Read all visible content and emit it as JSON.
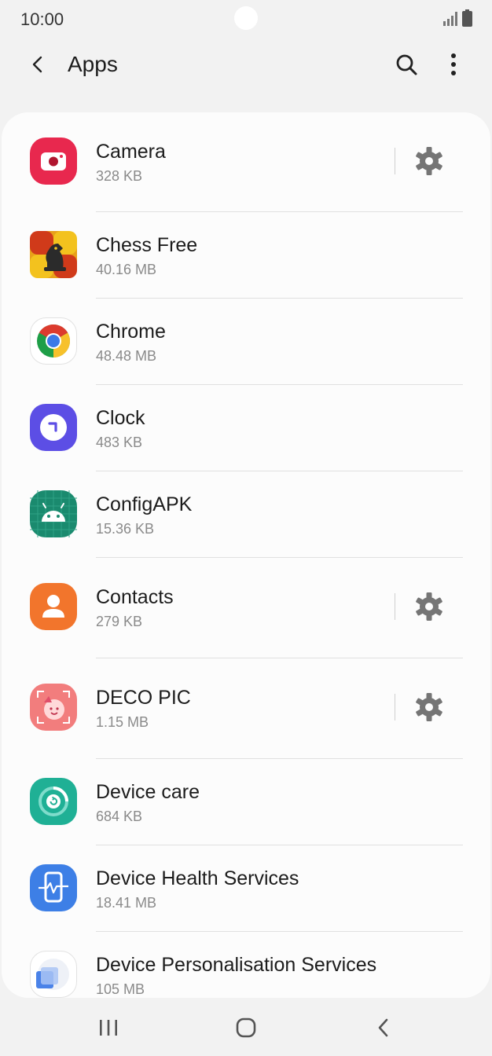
{
  "status_bar": {
    "time": "10:00"
  },
  "app_bar": {
    "title": "Apps"
  },
  "apps": [
    {
      "name": "Camera",
      "size": "328 KB",
      "has_settings": true
    },
    {
      "name": "Chess Free",
      "size": "40.16 MB",
      "has_settings": false
    },
    {
      "name": "Chrome",
      "size": "48.48 MB",
      "has_settings": false
    },
    {
      "name": "Clock",
      "size": "483 KB",
      "has_settings": false
    },
    {
      "name": "ConfigAPK",
      "size": "15.36 KB",
      "has_settings": false
    },
    {
      "name": "Contacts",
      "size": "279 KB",
      "has_settings": true
    },
    {
      "name": "DECO PIC",
      "size": "1.15 MB",
      "has_settings": true
    },
    {
      "name": "Device care",
      "size": "684 KB",
      "has_settings": false
    },
    {
      "name": "Device Health Services",
      "size": "18.41 MB",
      "has_settings": false
    },
    {
      "name": "Device Personalisation Services",
      "size": "105 MB",
      "has_settings": false
    }
  ],
  "icons": {
    "back": "arrow-back-icon",
    "search": "search-icon",
    "more": "more-vertical-icon",
    "settings": "gear-icon",
    "nav_recents": "recents-icon",
    "nav_home": "home-icon",
    "nav_back": "nav-back-icon"
  },
  "colors": {
    "background": "#f2f2f2",
    "card": "#fcfcfc",
    "camera": "#e8284e",
    "clock": "#5c4ee5",
    "configapk": "#1a8a6e",
    "contacts": "#f2752c",
    "decopic": "#f27d7d",
    "device_care": "#1fb095",
    "device_health": "#3d7fe6",
    "gear": "#757575"
  }
}
